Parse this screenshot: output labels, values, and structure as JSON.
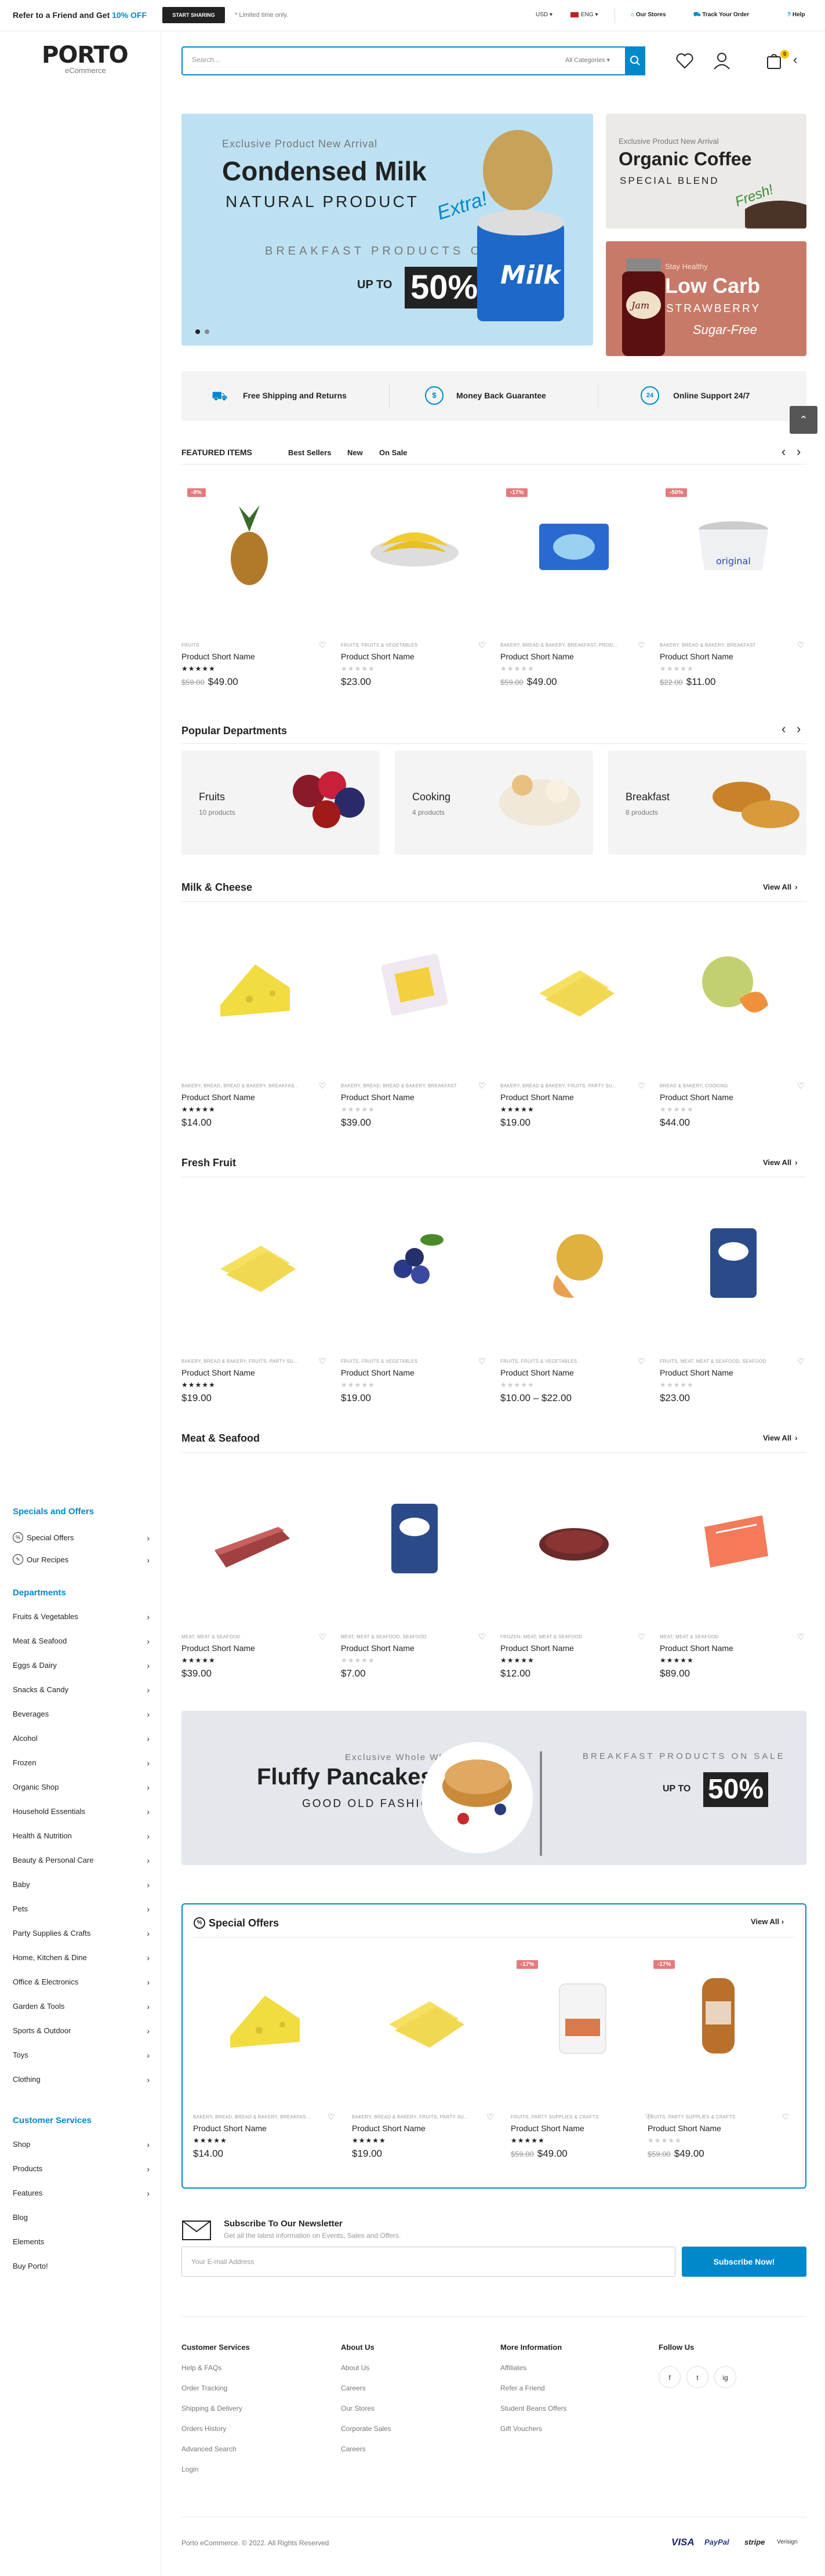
{
  "topbar": {
    "promo_prefix": "Refer to a Friend and Get ",
    "promo_highlight": "10% OFF",
    "start_button": "START SHARING",
    "limited": "* Limited time only.",
    "currency": "USD",
    "language": "ENG",
    "links": [
      "Our Stores",
      "Track Your Order",
      "Help"
    ]
  },
  "logo": {
    "name": "PORTO",
    "sub": "eCommerce"
  },
  "search": {
    "placeholder": "Search...",
    "category": "All Categories"
  },
  "cart": {
    "count": "0"
  },
  "sidebar": {
    "specials_heading": "Specials and Offers",
    "specials": [
      "Special Offers",
      "Our Recipes"
    ],
    "departments_heading": "Departments",
    "departments": [
      "Fruits & Vegetables",
      "Meat & Seafood",
      "Eggs & Dairy",
      "Snacks & Candy",
      "Beverages",
      "Alcohol",
      "Frozen",
      "Organic Shop",
      "Household Essentials",
      "Health & Nutrition",
      "Beauty & Personal Care",
      "Baby",
      "Pets",
      "Party Supplies & Crafts",
      "Home, Kitchen & Dine",
      "Office & Electronics",
      "Garden & Tools",
      "Sports & Outdoor",
      "Toys",
      "Clothing"
    ],
    "services_heading": "Customer Services",
    "services": [
      "Shop",
      "Products",
      "Features",
      "Blog",
      "Elements",
      "Buy Porto!"
    ]
  },
  "hero": {
    "main": {
      "kicker": "Exclusive Product New Arrival",
      "title": "Condensed Milk",
      "subtitle": "NATURAL PRODUCT",
      "script": "Extra!",
      "line": "BREAKFAST PRODUCTS ON SALE",
      "upto": "UP TO",
      "pct": "50%",
      "can_label": "Milk"
    },
    "side1": {
      "kicker": "Exclusive Product New Arrival",
      "title": "Organic Coffee",
      "subtitle": "SPECIAL BLEND",
      "script": "Fresh!"
    },
    "side2": {
      "kicker": "Stay Healthy",
      "title": "Low Carb",
      "subtitle": "STRAWBERRY",
      "script": "Sugar-Free",
      "jar_label": "Jam"
    }
  },
  "benefits": [
    "Free Shipping and Returns",
    "Money Back Guarantee",
    "Online Support 24/7"
  ],
  "featured": {
    "heading": "FEATURED ITEMS",
    "tabs": [
      "Best Sellers",
      "New",
      "On Sale"
    ],
    "products": [
      {
        "badge": "-9%",
        "cat": "FRUITS",
        "name": "Product Short Name",
        "rating": 5,
        "old": "$59.00",
        "price": "$49.00"
      },
      {
        "badge": "",
        "cat": "FRUITS, FRUITS & VEGETABLES",
        "name": "Product Short Name",
        "rating": 0,
        "old": "",
        "price": "$23.00"
      },
      {
        "badge": "-17%",
        "cat": "BAKERY, BREAD & BAKERY, BREAKFAST, PROD...",
        "name": "Product Short Name",
        "rating": 0,
        "old": "$59.00",
        "price": "$49.00"
      },
      {
        "badge": "-50%",
        "cat": "BAKERY, BREAD & BAKERY, BREAKFAST",
        "name": "Product Short Name",
        "rating": 0,
        "old": "$22.00",
        "price": "$11.00"
      }
    ]
  },
  "departments": {
    "heading": "Popular Departments",
    "items": [
      {
        "name": "Fruits",
        "count": "10 products"
      },
      {
        "name": "Cooking",
        "count": "4 products"
      },
      {
        "name": "Breakfast",
        "count": "8 products"
      }
    ]
  },
  "milk": {
    "heading": "Milk & Cheese",
    "viewall": "View All",
    "products": [
      {
        "cat": "BAKERY, BREAD, BREAD & BAKERY, BREAKFAS...",
        "name": "Product Short Name",
        "rating": 5,
        "old": "",
        "price": "$14.00"
      },
      {
        "cat": "BAKERY, BREAD, BREAD & BAKERY, BREAKFAST",
        "name": "Product Short Name",
        "rating": 0,
        "old": "",
        "price": "$39.00"
      },
      {
        "cat": "BAKERY, BREAD & BAKERY, FRUITS, PARTY SU...",
        "name": "Product Short Name",
        "rating": 5,
        "old": "",
        "price": "$19.00"
      },
      {
        "cat": "BREAD & BAKERY, COOKING",
        "name": "Product Short Name",
        "rating": 0,
        "old": "",
        "price": "$44.00"
      }
    ]
  },
  "fruit": {
    "heading": "Fresh Fruit",
    "viewall": "View All",
    "products": [
      {
        "cat": "BAKERY, BREAD & BAKERY, FRUITS, PARTY SU...",
        "name": "Product Short Name",
        "rating": 5,
        "old": "",
        "price": "$19.00"
      },
      {
        "cat": "FRUITS, FRUITS & VEGETABLES",
        "name": "Product Short Name",
        "rating": 0,
        "old": "",
        "price": "$19.00"
      },
      {
        "cat": "FRUITS, FRUITS & VEGETABLES",
        "name": "Product Short Name",
        "rating": 0,
        "old": "",
        "price": "$10.00 – $22.00"
      },
      {
        "cat": "FRUITS, MEAT, MEAT & SEAFOOD, SEAFOOD",
        "name": "Product Short Name",
        "rating": 0,
        "old": "",
        "price": "$23.00"
      }
    ]
  },
  "meat": {
    "heading": "Meat & Seafood",
    "viewall": "View All",
    "products": [
      {
        "cat": "MEAT, MEAT & SEAFOOD",
        "name": "Product Short Name",
        "rating": 5,
        "old": "",
        "price": "$39.00"
      },
      {
        "cat": "MEAT, MEAT & SEAFOOD, SEAFOOD",
        "name": "Product Short Name",
        "rating": 0,
        "old": "",
        "price": "$7.00"
      },
      {
        "cat": "FROZEN, MEAT, MEAT & SEAFOOD",
        "name": "Product Short Name",
        "rating": 5,
        "old": "",
        "price": "$12.00"
      },
      {
        "cat": "MEAT, MEAT & SEAFOOD",
        "name": "Product Short Name",
        "rating": 5,
        "old": "",
        "price": "$89.00"
      }
    ]
  },
  "promo2": {
    "kicker": "Exclusive Whole Wheat",
    "title": "Fluffy Pancakes",
    "subtitle": "GOOD OLD FASHIONED",
    "line": "BREAKFAST PRODUCTS ON SALE",
    "upto": "UP TO",
    "pct": "50%"
  },
  "offers": {
    "heading": "Special Offers",
    "viewall": "View All",
    "products": [
      {
        "badge": "",
        "cat": "BAKERY, BREAD, BREAD & BAKERY, BREAKFAS...",
        "name": "Product Short Name",
        "rating": 5,
        "old": "",
        "price": "$14.00"
      },
      {
        "badge": "",
        "cat": "BAKERY, BREAD & BAKERY, FRUITS, PARTY SU...",
        "name": "Product Short Name",
        "rating": 5,
        "old": "",
        "price": "$19.00"
      },
      {
        "badge": "-17%",
        "cat": "FRUITS, PARTY SUPPLIES & CRAFTS",
        "name": "Product Short Name",
        "rating": 5,
        "old": "$59.00",
        "price": "$49.00"
      },
      {
        "badge": "-17%",
        "cat": "FRUITS, PARTY SUPPLIES & CRAFTS",
        "name": "Product Short Name",
        "rating": 0,
        "old": "$59.00",
        "price": "$49.00"
      }
    ]
  },
  "newsletter": {
    "title": "Subscribe To Our Newsletter",
    "sub": "Get all the latest information on Events, Sales and Offers.",
    "placeholder": "Your E-mail Address",
    "button": "Subscribe Now!"
  },
  "footer": {
    "cols": [
      {
        "title": "Customer Services",
        "links": [
          "Help & FAQs",
          "Order Tracking",
          "Shipping & Delivery",
          "Orders History",
          "Advanced Search",
          "Login"
        ]
      },
      {
        "title": "About Us",
        "links": [
          "About Us",
          "Careers",
          "Our Stores",
          "Corporate Sales",
          "Careers"
        ]
      },
      {
        "title": "More Information",
        "links": [
          "Affiliates",
          "Refer a Friend",
          "Student Beans Offers",
          "Gift Vouchers"
        ]
      }
    ],
    "follow": "Follow Us",
    "social": [
      "f",
      "t",
      "ig"
    ],
    "copyright": "Porto eCommerce. © 2022. All Rights Reserved",
    "payments": [
      "VISA",
      "PayPal",
      "stripe",
      "Verisign"
    ]
  },
  "colors": {
    "accent": "#0088cc",
    "sale": "#e27c7c",
    "star": "#222222"
  }
}
